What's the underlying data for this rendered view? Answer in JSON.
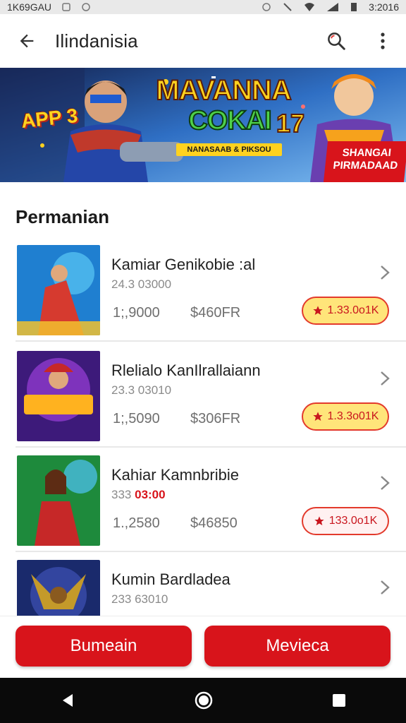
{
  "status_bar": {
    "carrier": "1K69GAU",
    "time": "3:2016"
  },
  "app_bar": {
    "title": "Ilindanisia"
  },
  "banner": {
    "tag": "APP 3",
    "title_line1": "MAVANNA",
    "title_line2": "COKAI",
    "title_number": "17",
    "subtitle": "NANASAAB & PIKSOU",
    "ribbon_line1": "SHANGAI",
    "ribbon_line2": "PIRMADAAD"
  },
  "section": {
    "title": "Permanian"
  },
  "games": [
    {
      "name": "Kamiar Genikobie :al",
      "sub": "24.3 03000",
      "sub_highlight": "",
      "players": "1;,9000",
      "price": "$460FR",
      "badge": "1.33.0o1K",
      "badge_style": "yellow",
      "thumb_colors": [
        "#1f7fd0",
        "#5ac8f5",
        "#d63a2f"
      ]
    },
    {
      "name": "Rlelialo KanIlrallaiann",
      "sub": "23.3 03010",
      "sub_highlight": "",
      "players": "1;,5090",
      "price": "$306FR",
      "badge": "1.3.3o01K",
      "badge_style": "yellow",
      "thumb_colors": [
        "#3d1a7a",
        "#9a3fd8",
        "#ffb21f"
      ]
    },
    {
      "name": "Kahiar Kamnbribie",
      "sub": "333",
      "sub_highlight": "03:00",
      "players": "1.,2580",
      "price": "$46850",
      "badge": "133.0o1K",
      "badge_style": "pink",
      "thumb_colors": [
        "#1e8a3c",
        "#4fc3f7",
        "#c62828"
      ]
    },
    {
      "name": "Kumin Bardladea",
      "sub": "233 63010",
      "sub_highlight": "",
      "players": "",
      "price": "",
      "badge": "",
      "badge_style": "yellow",
      "thumb_colors": [
        "#1a2a6c",
        "#3f51b5",
        "#c49a2a"
      ]
    }
  ],
  "actions": {
    "left_label": "Bumeain",
    "right_label": "Mevieca"
  },
  "colors": {
    "accent_red": "#d8141b",
    "badge_yellow": "#ffe57a"
  },
  "icons": {
    "back": "arrow-left-icon",
    "search": "search-icon",
    "more": "more-vert-icon",
    "chevron": "chevron-right-icon",
    "star": "star-icon",
    "nav_back": "nav-back-icon",
    "nav_home": "nav-home-icon",
    "nav_recent": "nav-recent-icon"
  }
}
